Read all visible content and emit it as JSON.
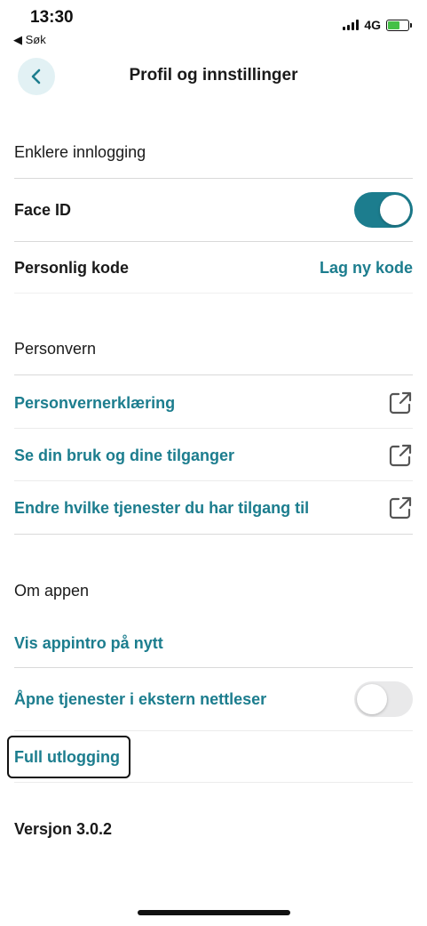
{
  "status_bar": {
    "time": "13:30",
    "back_label": "◀ Søk",
    "network": "4G"
  },
  "header": {
    "title": "Profil og innstillinger",
    "back_icon": "chevron-left-icon"
  },
  "sections": {
    "login": {
      "heading": "Enklere innlogging",
      "face_id_label": "Face ID",
      "face_id_enabled": true,
      "personal_code_label": "Personlig kode",
      "new_code_label": "Lag ny kode"
    },
    "privacy": {
      "heading": "Personvern",
      "items": [
        {
          "label": "Personvernerklæring",
          "icon": "external-link-icon"
        },
        {
          "label": "Se din bruk og dine tilganger",
          "icon": "external-link-icon"
        },
        {
          "label": "Endre hvilke tjenester du har tilgang til",
          "icon": "external-link-icon"
        }
      ]
    },
    "about": {
      "heading": "Om appen",
      "intro_label": "Vis appintro på nytt",
      "external_browser_label": "Åpne tjenester i ekstern nettleser",
      "external_browser_enabled": false,
      "logout_label": "Full utlogging"
    }
  },
  "version": "Versjon 3.0.2",
  "colors": {
    "accent": "#1c7d8e",
    "back_button_bg": "#e2f1f4",
    "divider": "#d9d9d9",
    "battery": "#44c047"
  }
}
